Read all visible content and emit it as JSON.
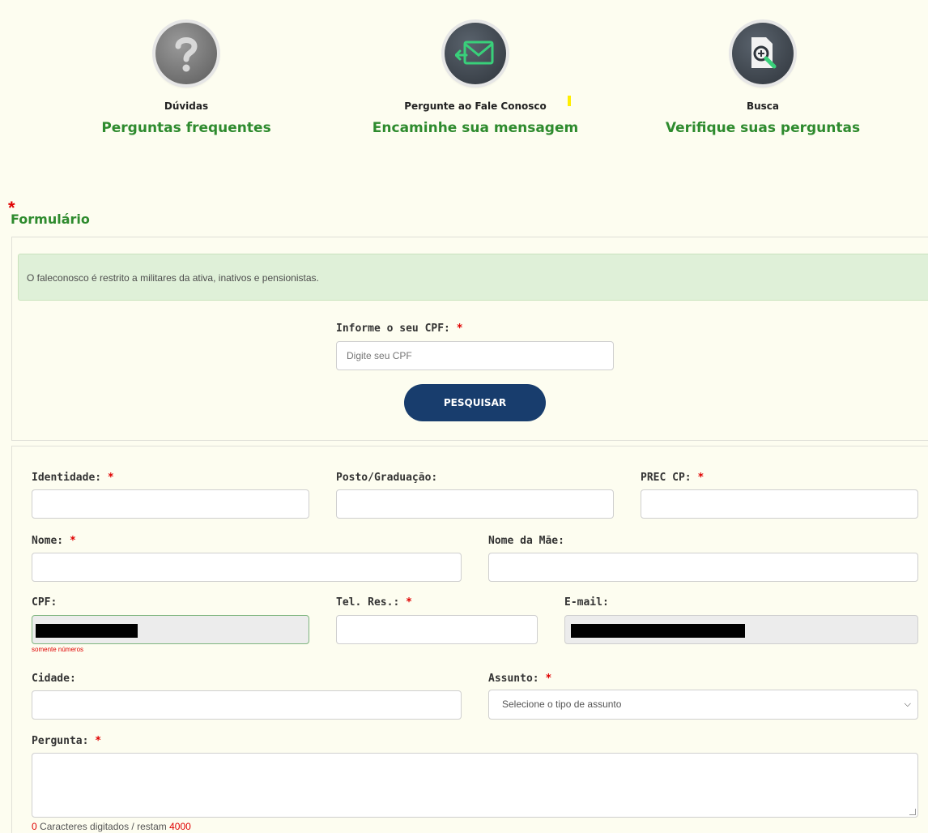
{
  "tiles": [
    {
      "icon": "question-icon",
      "small": "Dúvidas",
      "big": "Perguntas frequentes"
    },
    {
      "icon": "envelope-icon",
      "small": "Pergunte ao Fale Conosco",
      "big": "Encaminhe sua mensagem"
    },
    {
      "icon": "document-search-icon",
      "small": "Busca",
      "big": "Verifique suas perguntas"
    }
  ],
  "form": {
    "title": "Formulário",
    "required_mark": "*"
  },
  "alert": "O faleconosco é restrito a militares da ativa, inativos e pensionistas.",
  "search": {
    "label": "Informe o seu CPF:",
    "placeholder": "Digite seu CPF",
    "button": "PESQUISAR"
  },
  "fields": {
    "identidade": "Identidade:",
    "posto": "Posto/Graduação:",
    "prec": "PREC CP:",
    "nome": "Nome:",
    "nome_mae": "Nome da Mãe:",
    "cpf": "CPF:",
    "cpf_hint": "somente números",
    "tel": "Tel. Res.:",
    "email": "E-mail:",
    "cidade": "Cidade:",
    "assunto": "Assunto:",
    "assunto_selected": "Selecione o tipo de assunto",
    "pergunta": "Pergunta:"
  },
  "counter": {
    "typed": "0",
    "text": " Caracteres digitados / restam ",
    "remaining": "4000"
  },
  "colors": {
    "green": "#2e8b2e",
    "button": "#183d6d",
    "required": "#e00000",
    "alert_bg": "#dff0d8"
  }
}
